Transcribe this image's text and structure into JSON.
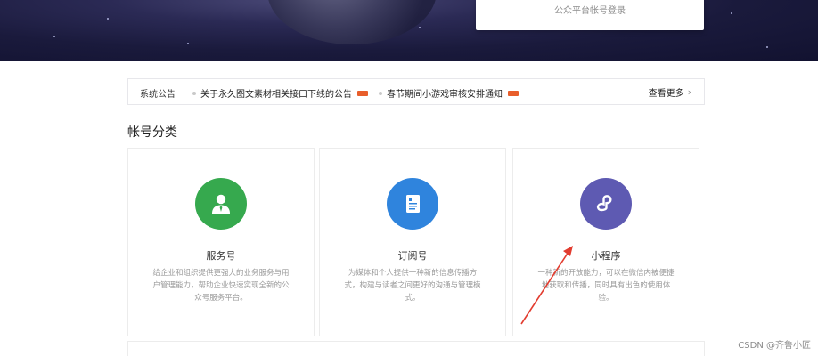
{
  "hero": {
    "login_link": "公众平台帐号登录"
  },
  "notice": {
    "label": "系统公告",
    "items": [
      {
        "text": "关于永久图文素材相关接口下线的公告"
      },
      {
        "text": "春节期间小游戏审核安排通知"
      }
    ],
    "badge_color": "#e85e2b",
    "more": "查看更多"
  },
  "section": {
    "title": "帐号分类"
  },
  "cards": [
    {
      "title": "服务号",
      "desc": "给企业和组织提供更强大的业务服务与用户管理能力，帮助企业快速实现全新的公众号服务平台。",
      "icon": "user-icon",
      "color": "#36a94e"
    },
    {
      "title": "订阅号",
      "desc": "为媒体和个人提供一种新的信息传播方式，构建与读者之间更好的沟通与管理模式。",
      "icon": "document-icon",
      "color": "#2f84dd"
    },
    {
      "title": "小程序",
      "desc": "一种新的开放能力，可以在微信内被便捷地获取和传播，同时具有出色的使用体验。",
      "icon": "miniprogram-icon",
      "color": "#5e5ab2"
    }
  ],
  "annotation": {
    "arrow_color": "#e23c2f"
  },
  "watermark": "CSDN @齐鲁小匠"
}
